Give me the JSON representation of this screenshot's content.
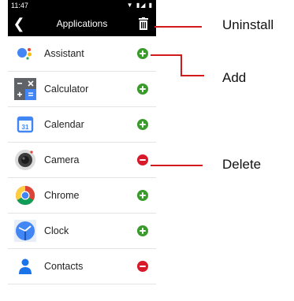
{
  "status_bar": {
    "time": "11:47",
    "icons": "▼ ▮◢ ▮"
  },
  "app_bar": {
    "title": "Applications"
  },
  "apps": [
    {
      "name": "Assistant",
      "action": "add"
    },
    {
      "name": "Calculator",
      "action": "add"
    },
    {
      "name": "Calendar",
      "action": "add"
    },
    {
      "name": "Camera",
      "action": "remove"
    },
    {
      "name": "Chrome",
      "action": "add"
    },
    {
      "name": "Clock",
      "action": "add"
    },
    {
      "name": "Contacts",
      "action": "remove"
    }
  ],
  "calendar_icon_day": "31",
  "callouts": {
    "uninstall": "Uninstall",
    "add": "Add",
    "delete": "Delete"
  },
  "colors": {
    "add": "#3a9b2c",
    "remove": "#d8192a",
    "callout_line": "#d11a1a"
  }
}
